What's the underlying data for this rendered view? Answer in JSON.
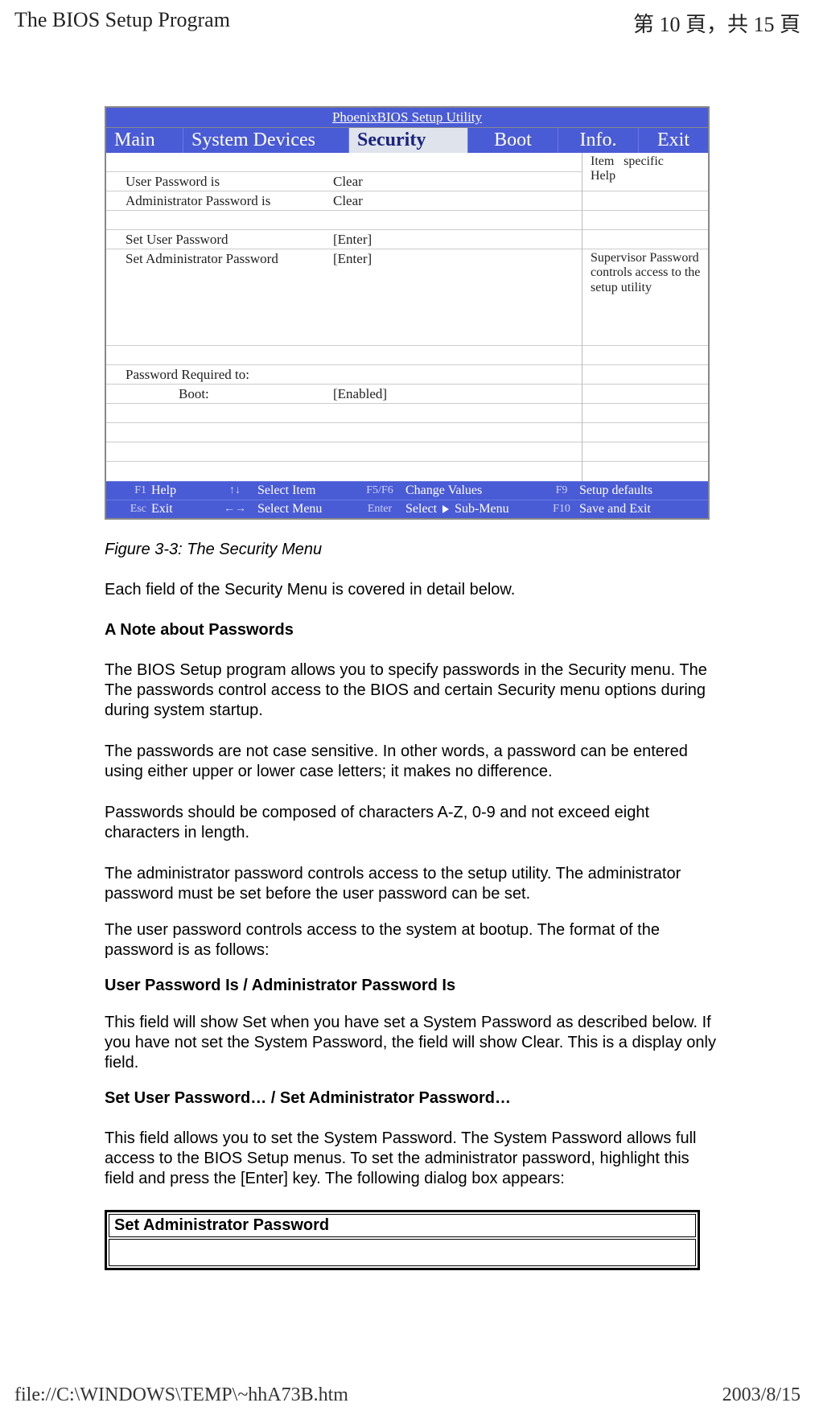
{
  "header": {
    "left": "The BIOS Setup Program",
    "right": "第 10 頁，共 15 頁"
  },
  "bios": {
    "title": "PhoenixBIOS Setup Utility",
    "tabs": {
      "main": "Main",
      "system_devices": "System Devices",
      "security": "Security",
      "boot": "Boot",
      "info": "Info.",
      "exit": "Exit"
    },
    "help_header_line1": "Item",
    "help_header_line2": "Help",
    "help_header_right": "specific",
    "rows": {
      "user_pw_label": "User Password is",
      "user_pw_value": "Clear",
      "admin_pw_label": "Administrator Password is",
      "admin_pw_value": "Clear",
      "set_user_label": "Set User Password",
      "set_user_value": "[Enter]",
      "set_admin_label": "Set Administrator Password",
      "set_admin_value": "[Enter]",
      "set_admin_help": "Supervisor Password controls access to the setup utility",
      "pw_required_label": "Password Required to:",
      "boot_label": "Boot:",
      "boot_value": "[Enabled]"
    },
    "footer": {
      "r1": {
        "k1": "F1",
        "l1": "Help",
        "k2": "↑↓",
        "l2": "Select Item",
        "k3": "F5/F6",
        "l3": "Change Values",
        "k4": "F9",
        "l4": "Setup defaults"
      },
      "r2": {
        "k1": "Esc",
        "l1": "Exit",
        "k2": "←→",
        "l2": "Select Menu",
        "k3": "Enter",
        "l3": "Select ▶ Sub-Menu",
        "k4": "F10",
        "l4": "Save and Exit"
      }
    }
  },
  "doc": {
    "caption": "Figure 3-3: The Security Menu",
    "intro": "Each field of the Security Menu is covered in detail below.",
    "h_note": "A Note about Passwords",
    "p1": "The BIOS Setup program allows you to specify passwords in the Security menu. The The passwords control access to the BIOS and certain Security menu options during during system startup.",
    "p2": "The passwords are not case sensitive. In other words, a password can be entered using either upper or lower case letters; it makes no difference.",
    "p3": "Passwords should be composed of characters A-Z, 0-9 and not exceed eight characters in length.",
    "p4": "The administrator password controls access to the setup utility. The administrator password must be set before the user password can be set.",
    "p5": "The user password controls access to the system at bootup. The format of the password is as follows:",
    "h_pw_is": "User Password Is / Administrator Password Is",
    "p6": "This field will show Set when you have set a System Password as described below. If you have not set the System Password, the field will show Clear. This is a display only field.",
    "h_set_pw": "Set User Password… / Set Administrator Password…",
    "p7": "This field allows you to set the System Password. The System Password allows full access to the BIOS Setup menus. To set the administrator password, highlight this field and press the [Enter] key. The following dialog box appears:",
    "dialog_title": "Set Administrator Password"
  },
  "footer": {
    "left": "file://C:\\WINDOWS\\TEMP\\~hhA73B.htm",
    "right": "2003/8/15"
  }
}
